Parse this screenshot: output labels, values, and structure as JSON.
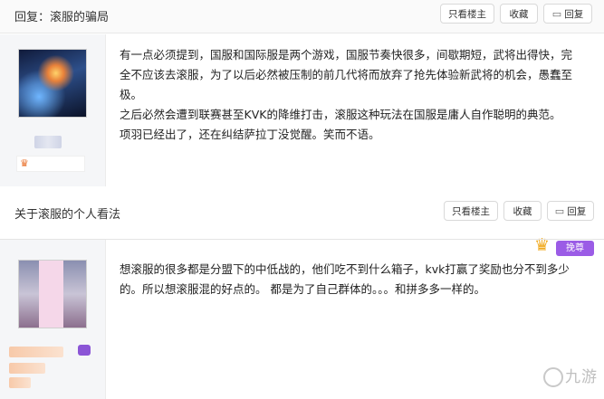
{
  "posts": [
    {
      "title": "回复：滚服的骗局",
      "actions": {
        "only_host": "只看楼主",
        "collect": "收藏",
        "reply": "回复"
      },
      "paragraphs": [
        "有一点必须提到，国服和国际服是两个游戏，国服节奏快很多，间歇期短，武将出得快，完全不应该去滚服，为了以后必然被压制的前几代将而放弃了抢先体验新武将的机会，愚蠢至极。",
        "之后必然会遭到联赛甚至KVK的降维打击，滚服这种玩法在国服是庸人自作聪明的典范。",
        "项羽已经出了，还在纠结萨拉丁没觉醒。笑而不语。"
      ]
    },
    {
      "title": "关于滚服的个人看法",
      "actions": {
        "only_host": "只看楼主",
        "collect": "收藏",
        "reply": "回复"
      },
      "hot_tag": "挽尊",
      "paragraphs": [
        "想滚服的很多都是分盟下的中低战的，他们吃不到什么箱子，kvk打赢了奖励也分不到多少的。所以想滚服混的好点的。 都是为了自己群体的。。。和拼多多一样的。"
      ]
    }
  ],
  "watermark": "九游",
  "icons": {
    "reply": "reply-icon",
    "crown": "crown-icon"
  },
  "colors": {
    "accent_purple": "#9b5ce6",
    "crown_gold": "#f0a81a",
    "header_bg": "#fafafa"
  }
}
